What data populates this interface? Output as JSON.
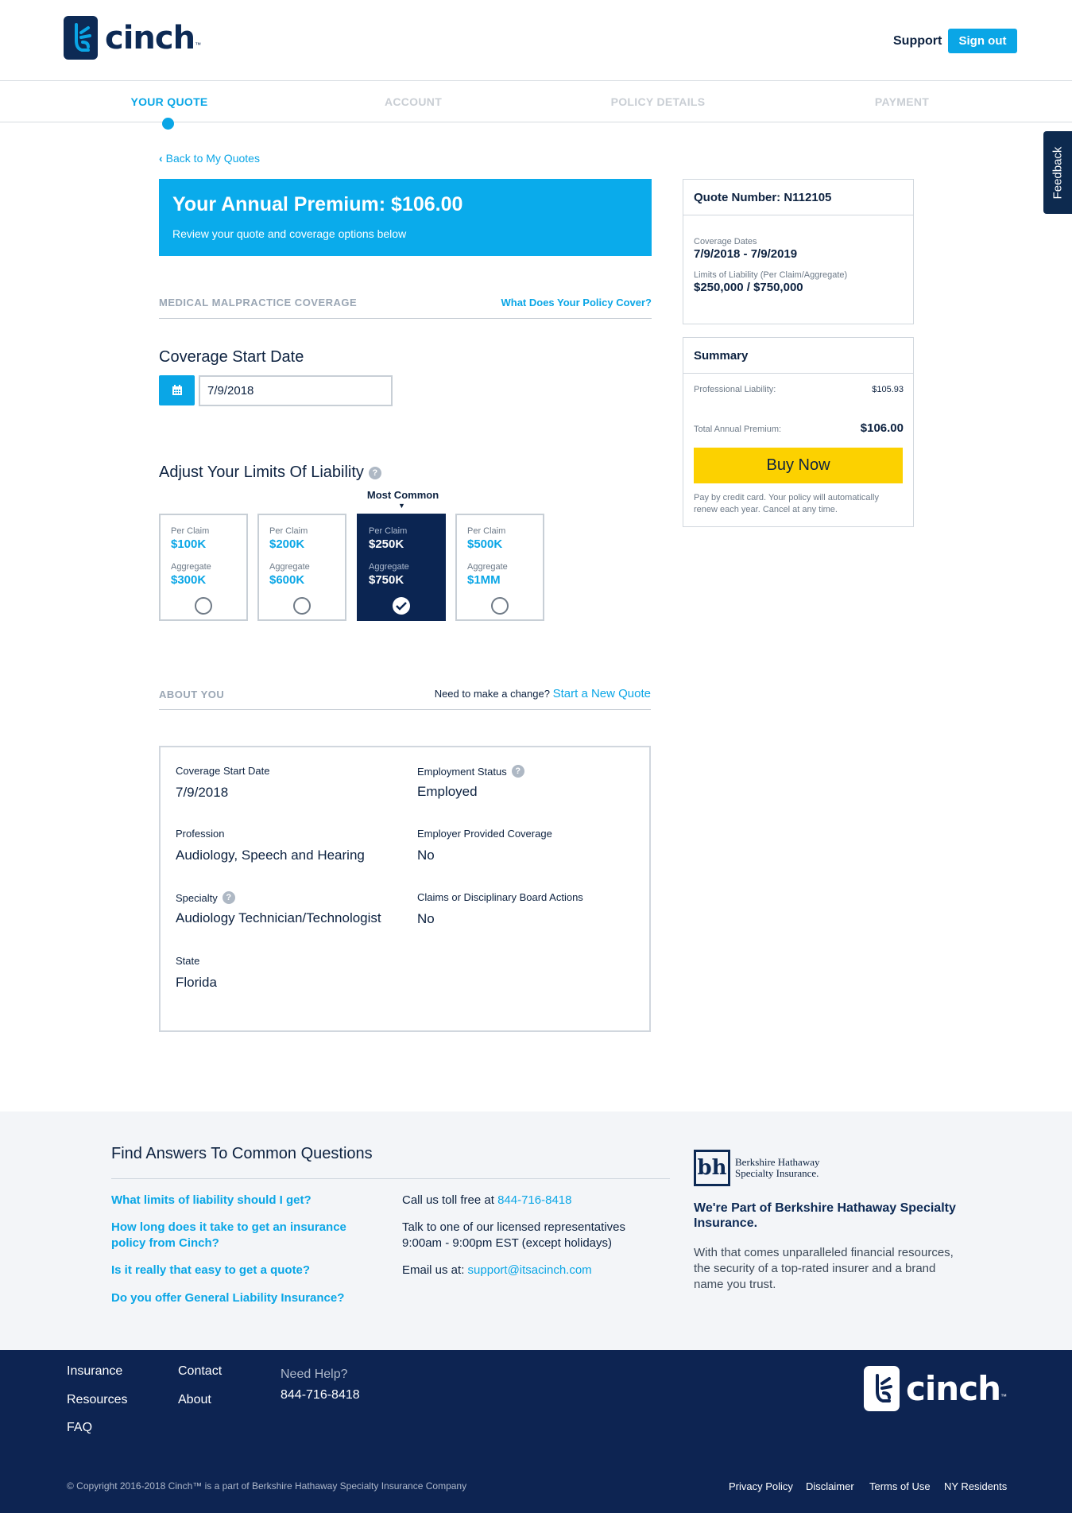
{
  "header": {
    "brand": "cinch",
    "brand_tm": "™",
    "support_label": "Support",
    "signout_label": "Sign out"
  },
  "steps": [
    {
      "label": "YOUR QUOTE",
      "active": true
    },
    {
      "label": "ACCOUNT",
      "active": false
    },
    {
      "label": "POLICY DETAILS",
      "active": false
    },
    {
      "label": "PAYMENT",
      "active": false
    }
  ],
  "feedback_label": "Feedback",
  "back_link": "Back to My Quotes",
  "premium": {
    "title": "Your Annual Premium: $106.00",
    "subtitle": "Review your quote and coverage options below"
  },
  "coverage_section": {
    "label": "MEDICAL MALPRACTICE COVERAGE",
    "link": "What Does Your Policy Cover?"
  },
  "start_date": {
    "title": "Coverage Start Date",
    "value": "7/9/2018"
  },
  "limits": {
    "title": "Adjust Your Limits Of Liability",
    "help": "?",
    "most_common": "Most Common",
    "per_claim_label": "Per Claim",
    "aggregate_label": "Aggregate",
    "options": [
      {
        "per_claim": "$100K",
        "aggregate": "$300K",
        "selected": false
      },
      {
        "per_claim": "$200K",
        "aggregate": "$600K",
        "selected": false
      },
      {
        "per_claim": "$250K",
        "aggregate": "$750K",
        "selected": true
      },
      {
        "per_claim": "$500K",
        "aggregate": "$1MM",
        "selected": false
      }
    ]
  },
  "about": {
    "label": "ABOUT YOU",
    "change_prompt": "Need to make a change?",
    "change_link": "Start a New Quote",
    "fields": {
      "coverage_start": {
        "label": "Coverage Start Date",
        "value": "7/9/2018"
      },
      "employment": {
        "label": "Employment Status",
        "value": "Employed"
      },
      "profession": {
        "label": "Profession",
        "value": "Audiology, Speech and Hearing"
      },
      "employer_coverage": {
        "label": "Employer Provided Coverage",
        "value": "No"
      },
      "specialty": {
        "label": "Specialty",
        "value": "Audiology Technician/Technologist"
      },
      "claims": {
        "label": "Claims or Disciplinary Board Actions",
        "value": "No"
      },
      "state": {
        "label": "State",
        "value": "Florida"
      }
    }
  },
  "quote": {
    "number_label": "Quote Number: N112105",
    "dates_label": "Coverage Dates",
    "dates_value": "7/9/2018 - 7/9/2019",
    "limits_label": "Limits of Liability (Per Claim/Aggregate)",
    "limits_value": "$250,000 / $750,000"
  },
  "summary": {
    "title": "Summary",
    "professional_label": "Professional Liability:",
    "professional_value": "$105.93",
    "total_label": "Total Annual Premium:",
    "total_value": "$106.00",
    "buy_label": "Buy Now",
    "note": "Pay by credit card. Your policy will automatically renew each year. Cancel at any time."
  },
  "faq": {
    "title": "Find Answers To Common Questions",
    "questions": [
      "What limits of liability should I get?",
      "How long does it take to get an insurance policy from Cinch?",
      "Is it really that easy to get a quote?",
      "Do you offer General Liability Insurance?"
    ],
    "toll_free_prefix": "Call us toll free at",
    "toll_free_number": "844-716-8418",
    "talk_line1": "Talk to one of our licensed representatives",
    "talk_line2": "9:00am - 9:00pm EST (except holidays)",
    "email_prefix": "Email us at:",
    "email": "support@itsacinch.com"
  },
  "berkshire": {
    "logo_mark": "bh",
    "logo_line1": "Berkshire Hathaway",
    "logo_line2": "Specialty Insurance.",
    "heading": "We're Part of Berkshire Hathaway Specialty Insurance.",
    "body": "With that comes unparalleled financial resources, the security of a top-rated insurer and a brand name you trust."
  },
  "footer": {
    "links_col1": [
      "Insurance",
      "Resources",
      "FAQ"
    ],
    "links_col2": [
      "Contact",
      "About"
    ],
    "need_help": "Need Help?",
    "phone": "844-716-8418",
    "brand": "cinch",
    "brand_tm": "™",
    "copyright": "© Copyright 2016-2018 Cinch™ is a part of Berkshire Hathaway Specialty Insurance Company",
    "legal": [
      "Privacy Policy",
      "Disclaimer",
      "Terms of Use",
      "NY Residents"
    ]
  }
}
